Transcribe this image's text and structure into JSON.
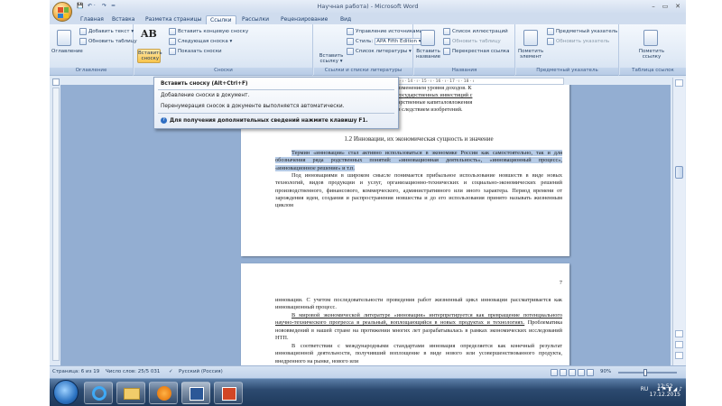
{
  "window": {
    "title": "Научная работа) - Microsoft Word",
    "min": "–",
    "max": "▭",
    "close": "✕"
  },
  "quick_access": {
    "save": "💾",
    "undo": "↶ ·",
    "redo": "↷",
    "more": "="
  },
  "tabs": [
    "Главная",
    "Вставка",
    "Разметка страницы",
    "Ссылки",
    "Рассылки",
    "Рецензирование",
    "Вид"
  ],
  "ribbon": {
    "toc": {
      "big_label": "Оглавление",
      "add_text": "Добавить текст ▾",
      "update_table": "Обновить таблицу",
      "group": "Оглавление"
    },
    "footnotes": {
      "big_label": "Вставить сноску",
      "ab": "AB",
      "insert_endnote": "Вставить концевую сноску",
      "next_footnote": "Следующая сноска ▾",
      "show_notes": "Показать сноски",
      "group": "Сноски"
    },
    "citations": {
      "insert_citation": "Вставить ссылку ▾",
      "manage_sources": "Управление источниками",
      "style_label": "Стиль:",
      "style_value": "APA Fifth Edition ▾",
      "bibliography": "Список литературы ▾",
      "group": "Ссылки и списки литературы"
    },
    "captions": {
      "insert_caption": "Вставить название",
      "table_of_figures": "Список иллюстраций",
      "update_table": "Обновить таблицу",
      "cross_reference": "Перекрестная ссылка",
      "group": "Названия"
    },
    "index": {
      "mark_entry": "Пометить элемент",
      "insert_index": "Предметный указатель",
      "update_index": "Обновить указатель",
      "group": "Предметный указатель"
    },
    "toa": {
      "mark_citation": "Пометить ссылку",
      "group": "Таблица ссылок"
    }
  },
  "tooltip": {
    "title": "Вставить сноску (Alt+Ctrl+F)",
    "desc1": "Добавление сноски в документ.",
    "desc2": "Перенумерация сносок в документе выполняется автоматически.",
    "help": "Для получения дополнительных сведений нажмите клавишу F1."
  },
  "ruler_marks": "· 8 · ı · 9 · ı · 10 · ı · 11 · ı · 12 · ı · 13 · ı · 14 · ı · 15 · ı · 16 · ı · 17 · ı · 18 · ı",
  "page1": {
    "line1": "торые не связаны с изменением уровня доходов. К",
    "line2": "значительная часть государственных инвестиций с",
    "line3": "ком освоения, государственные капиталовложения",
    "line4": "являющиеся прямым следствием изобретений.",
    "heading": "1.2 Инновации, их экономическая сущность и значение",
    "para1": "Термин «инновация» стал активно использоваться в экономике России как самостоятельно, так и для обозначения ряда родственных понятий: «инновационная деятельность», «инновационный процесс», «инновационное решение» и т.п.",
    "para2": "Под инновациями в широком смысле понимается прибыльное использование новшеств в виде новых технологий, видов продукции и услуг, организационно-технических и социально-экономических решений производственного, финансового, коммерческого, административного или иного характера. Период времени от зарождения идеи, создания и распространения новшества и до его использования принято называть жизненным циклом"
  },
  "page2": {
    "page_number": "7",
    "para1": "инновации. С учетом последовательности проведения работ жизненный цикл инновации рассматривается как инновационный процесс.",
    "para2a": "В мировой экономической литературе «инновация» интерпретируется как превращение потенциального научно-технического прогресса в реальный, воплощающийся в новых продуктах и технологиях.",
    "para2b": " Проблематика нововведений в нашей стране на протяжении многих лет разрабатывалась в рамках экономических исследований НТП.",
    "para3": "В соответствии с международными стандартами инновация определяется как конечный результат инновационной деятельности, получивший воплощение в виде нового или усовершенствованного продукта, внедренного на рынке, нового или"
  },
  "status": {
    "page": "Страница: 6 из 19",
    "words": "Число слов: 25/5 031",
    "lang": "Русский (Россия)",
    "zoom": "90%"
  },
  "taskbar": {
    "lang": "RU",
    "time": "12:52",
    "date": "17.12.2015"
  }
}
